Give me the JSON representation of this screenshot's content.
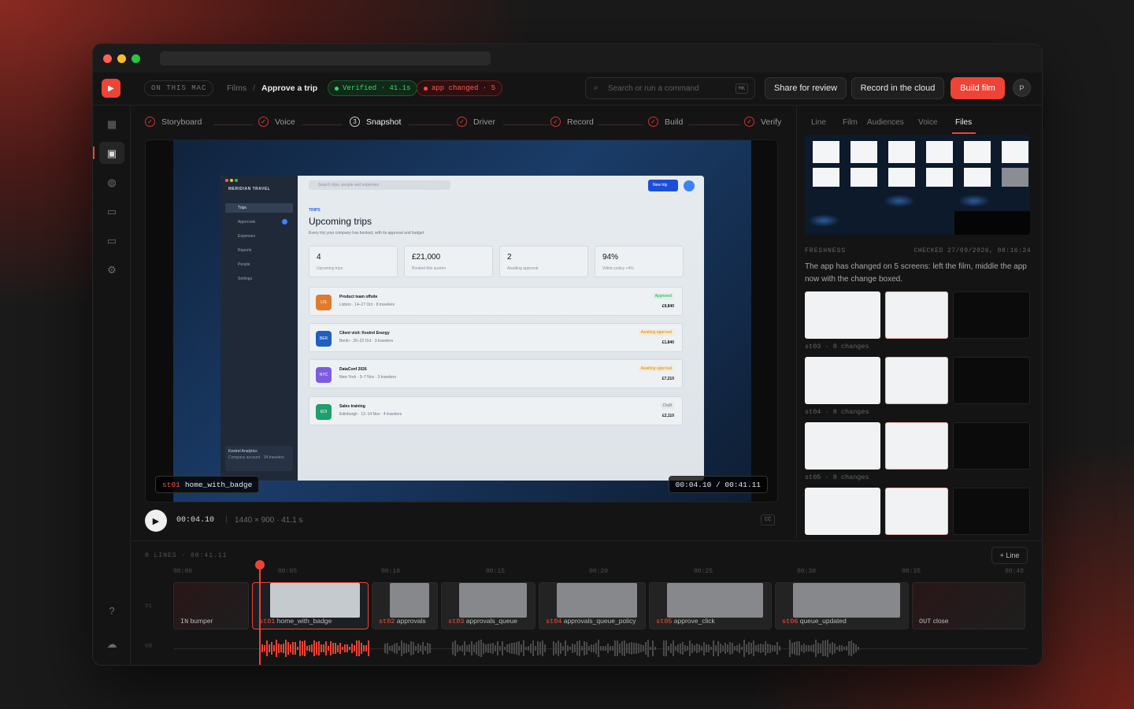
{
  "topbar": {
    "location": "ON THIS MAC",
    "breadcrumb_parent": "Films",
    "breadcrumb_sep": "/",
    "breadcrumb_current": "Approve a trip",
    "verified_label": "Verified · 41.1s",
    "changed_label": "app changed · 5",
    "search_placeholder": "Search or run a command",
    "search_shortcut": "⌘K",
    "share_label": "Share for review",
    "record_cloud_label": "Record in the cloud",
    "build_label": "Build film",
    "avatar": "P",
    "accent": "#ef4336"
  },
  "steps": [
    {
      "label": "Storyboard",
      "mark": "✓"
    },
    {
      "label": "Voice",
      "mark": "✓"
    },
    {
      "label": "Snapshot",
      "mark": "3"
    },
    {
      "label": "Driver",
      "mark": "✓"
    },
    {
      "label": "Record",
      "mark": "✓"
    },
    {
      "label": "Build",
      "mark": "✓"
    },
    {
      "label": "Verify",
      "mark": "✓"
    }
  ],
  "preview": {
    "app_name": "MERIDIAN TRAVEL",
    "nav": [
      "Trips",
      "Approvals",
      "Expenses",
      "Reports",
      "People",
      "Settings"
    ],
    "search": "Search trips, people and expenses",
    "new_trip": "New trip",
    "section": "TRIPS",
    "heading": "Upcoming trips",
    "sub": "Every trip your company has booked, with its approval and budget",
    "stats": [
      {
        "value": "4",
        "label": "Upcoming trips"
      },
      {
        "value": "£21,000",
        "label": "Booked this quarter"
      },
      {
        "value": "2",
        "label": "Awaiting approval"
      },
      {
        "value": "94%",
        "label": "Within policy +4%"
      }
    ],
    "trips": [
      {
        "code": "LIS",
        "title": "Product team offsite",
        "meta": "Lisbon · 14–17 Oct · 8 travelers",
        "status": "Approved",
        "amount": "£9,840",
        "color": "#e07b2e",
        "status_color": "#2f9e5a"
      },
      {
        "code": "BER",
        "title": "Client visit: Kestrel Energy",
        "meta": "Berlin · 20–22 Oct · 3 travelers",
        "status": "Awaiting approval",
        "amount": "£1,840",
        "color": "#1f5fbf",
        "status_color": "#d18a1b"
      },
      {
        "code": "NYC",
        "title": "DataConf 2026",
        "meta": "New York · 3–7 Nov · 3 travelers",
        "status": "Awaiting approval",
        "amount": "£7,210",
        "color": "#7c5ce0",
        "status_color": "#d18a1b"
      },
      {
        "code": "EDI",
        "title": "Sales training",
        "meta": "Edinburgh · 12–14 Nov · 4 travelers",
        "status": "Draft",
        "amount": "£2,110",
        "color": "#1f9e6e",
        "status_color": "#777777"
      }
    ],
    "footer_company": "Kestrel Analytics",
    "footer_note": "Company account · 34 travelers",
    "shot_id": "st01",
    "shot_name": "home_with_badge",
    "timecode": "00:04.10 / 00:41.11"
  },
  "player": {
    "time": "00:04.10",
    "meta": "1440 × 900 · 41.1 s",
    "cc": "CC"
  },
  "right_panel": {
    "tabs": [
      "Line",
      "Film",
      "Audiences",
      "Voice",
      "Files"
    ],
    "active_tab": "Files",
    "freshness_label": "FRESHNESS",
    "checked_label": "CHECKED 27/09/2026, 08:16:24",
    "freshness_text": "The app has changed on 5 screens: left the film, middle the app now with the change boxed.",
    "changes": [
      {
        "label": "st03 · 8 changes"
      },
      {
        "label": "st04 · 8 changes"
      },
      {
        "label": "st05 · 8 changes"
      },
      {
        "label": ""
      }
    ]
  },
  "timeline": {
    "summary": "8 LINES · 00:41.11",
    "add_line": "+ Line",
    "ticks": [
      "00:00",
      "00:05",
      "00:10",
      "00:15",
      "00:20",
      "00:25",
      "00:30",
      "00:35",
      "00:40"
    ],
    "track_v": "V1",
    "track_a": "VO",
    "clips": [
      {
        "tag": "IN",
        "name": "bumper"
      },
      {
        "tag": "st01",
        "name": "home_with_badge"
      },
      {
        "tag": "st02",
        "name": "approvals"
      },
      {
        "tag": "st03",
        "name": "approvals_queue"
      },
      {
        "tag": "st04",
        "name": "approvals_queue_policy"
      },
      {
        "tag": "st05",
        "name": "approve_click"
      },
      {
        "tag": "st06",
        "name": "queue_updated"
      },
      {
        "tag": "OUT",
        "name": "close"
      }
    ]
  }
}
